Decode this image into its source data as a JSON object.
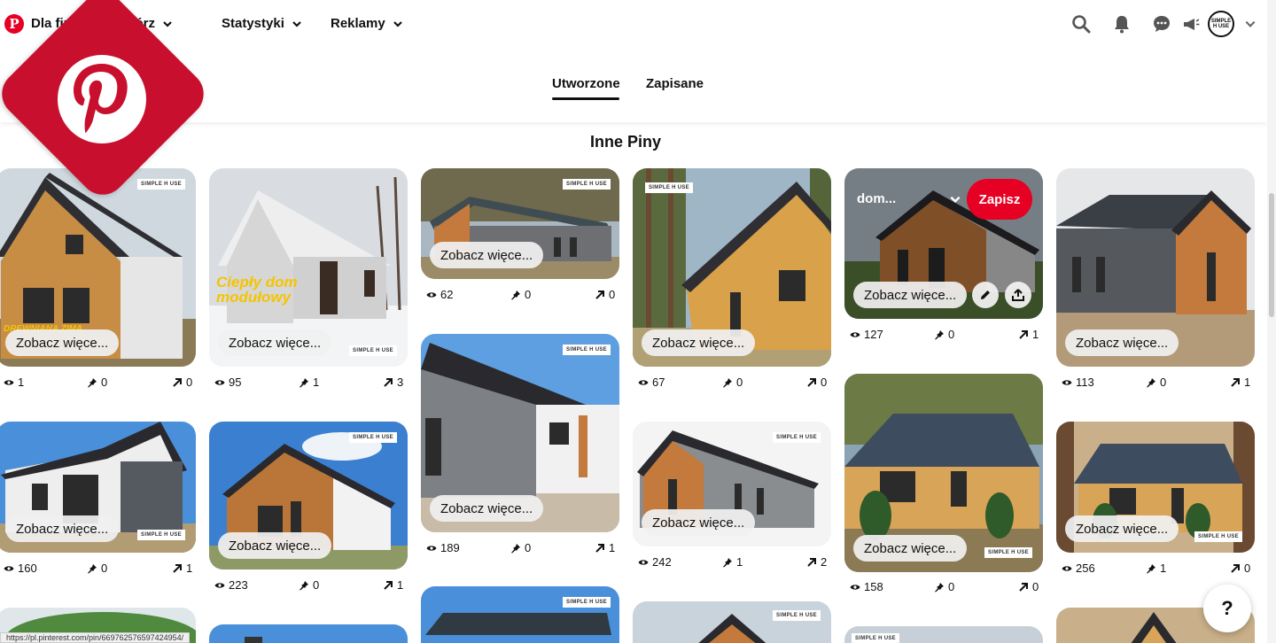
{
  "topbar": {
    "brand_label": "Dla firm",
    "nav": [
      {
        "label": "Utwórz"
      },
      {
        "label": "Statystyki"
      },
      {
        "label": "Reklamy"
      }
    ],
    "avatar_text_line1": "SIMPLE",
    "avatar_text_line2": "H USE",
    "icons": [
      "search-icon",
      "bell-icon",
      "chat-icon",
      "megaphone-icon",
      "chevron-down-icon"
    ]
  },
  "tabs": [
    {
      "label": "Utworzone",
      "active": true
    },
    {
      "label": "Zapisane",
      "active": false
    }
  ],
  "section_title": "Inne Piny",
  "see_more_label": "Zobacz więce...",
  "watermark_text": "SIMPLE H USE",
  "colors": {
    "accent": "#e60023",
    "logo": "#c8102e",
    "text": "#111111"
  },
  "pins": [
    {
      "views": "1",
      "saves": "0",
      "clicks": "0",
      "overlay_text": "DREWNIANA ZIMA"
    },
    {
      "views": "95",
      "saves": "1",
      "clicks": "3",
      "overlay_text": "Ciepły dom modułowy"
    },
    {
      "views": "62",
      "saves": "0",
      "clicks": "0"
    },
    {
      "views": "67",
      "saves": "0",
      "clicks": "0"
    },
    {
      "views": "127",
      "saves": "0",
      "clicks": "1",
      "board": "dom...",
      "save_label": "Zapisz"
    },
    {
      "views": "113",
      "saves": "0",
      "clicks": "1"
    },
    {
      "views": "160",
      "saves": "0",
      "clicks": "1"
    },
    {
      "views": "223",
      "saves": "0",
      "clicks": "1"
    },
    {
      "views": "189",
      "saves": "0",
      "clicks": "1"
    },
    {
      "views": "242",
      "saves": "1",
      "clicks": "2"
    },
    {
      "views": "158",
      "saves": "0",
      "clicks": "0"
    },
    {
      "views": "256",
      "saves": "1",
      "clicks": "0"
    }
  ],
  "help_label": "?",
  "status_url": "https://pl.pinterest.com/pin/669762576597424954/"
}
